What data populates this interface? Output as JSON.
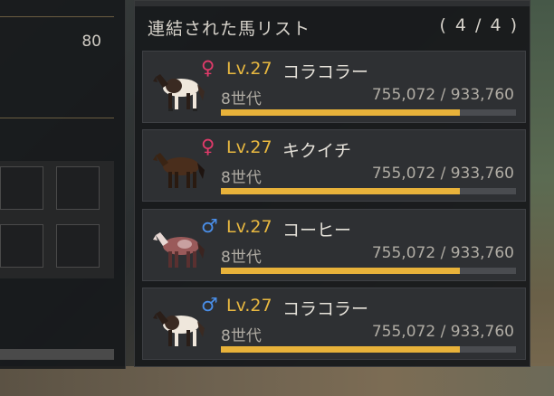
{
  "left_panel": {
    "count": "80"
  },
  "horse_list": {
    "title": "連結された馬リスト",
    "count": "( 4 / 4 )",
    "horses": [
      {
        "gender": "♀",
        "gender_type": "female",
        "level": "Lv.27",
        "name": "コラコラー",
        "generation": "8世代",
        "exp": "755,072 / 933,760",
        "exp_fraction": 0.8087,
        "coat": "piebald"
      },
      {
        "gender": "♀",
        "gender_type": "female",
        "level": "Lv.27",
        "name": "キクイチ",
        "generation": "8世代",
        "exp": "755,072 / 933,760",
        "exp_fraction": 0.8087,
        "coat": "dark-bay"
      },
      {
        "gender": "♂",
        "gender_type": "male",
        "level": "Lv.27",
        "name": "コーヒー",
        "generation": "8世代",
        "exp": "755,072 / 933,760",
        "exp_fraction": 0.8087,
        "coat": "chestnut-roan"
      },
      {
        "gender": "♂",
        "gender_type": "male",
        "level": "Lv.27",
        "name": "コラコラー",
        "generation": "8世代",
        "exp": "755,072 / 933,760",
        "exp_fraction": 0.8087,
        "coat": "piebald"
      }
    ]
  },
  "colors": {
    "level": "#e8b840",
    "exp_bar": "#e8b23a",
    "female": "#e03a6a",
    "male": "#4a8ee8"
  }
}
